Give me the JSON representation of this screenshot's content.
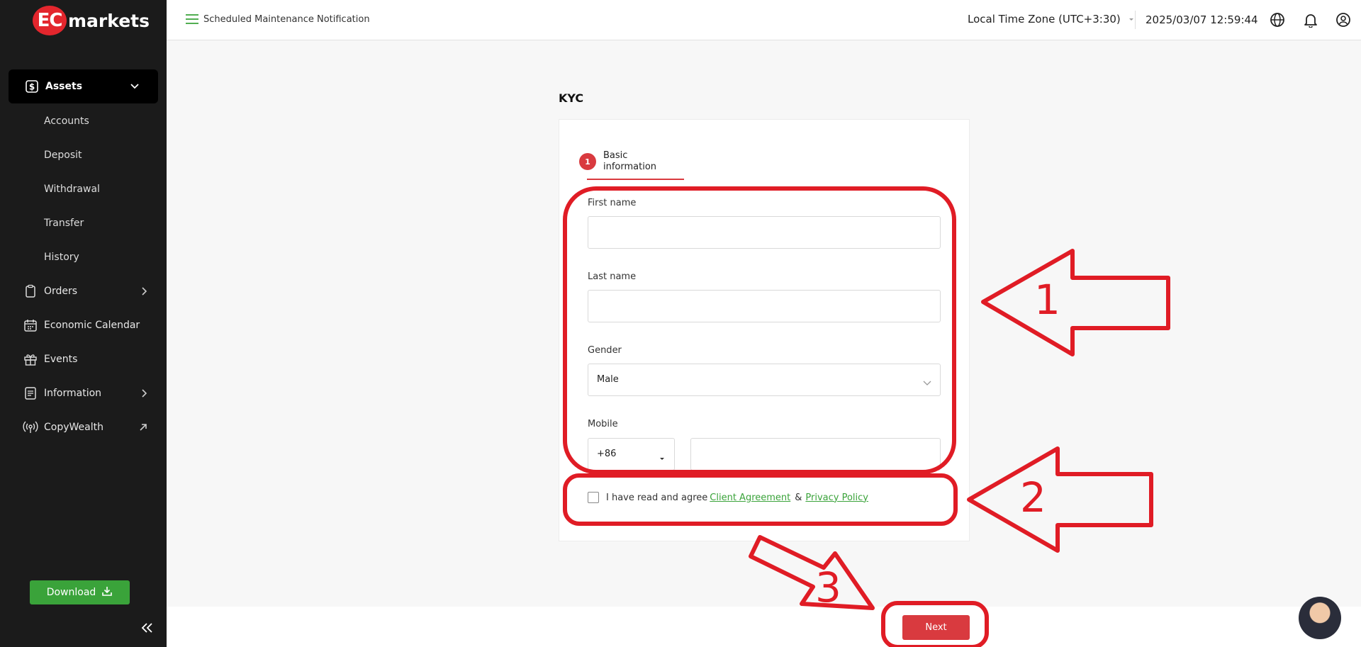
{
  "brand": {
    "logo_mark": "EC",
    "logo_text": "markets"
  },
  "sidebar": {
    "active": {
      "label": "Assets",
      "icon": "dollar-icon"
    },
    "sub_items": [
      "Accounts",
      "Deposit",
      "Withdrawal",
      "Transfer",
      "History"
    ],
    "items": [
      {
        "label": "Orders",
        "icon": "clipboard-icon",
        "arrow": "chevron-right"
      },
      {
        "label": "Economic Calendar",
        "icon": "calendar-icon"
      },
      {
        "label": "Events",
        "icon": "gift-icon"
      },
      {
        "label": "Information",
        "icon": "document-icon",
        "arrow": "chevron-right"
      },
      {
        "label": "CopyWealth",
        "icon": "broadcast-icon",
        "arrow": "external-arrow"
      }
    ],
    "download_label": "Download"
  },
  "header": {
    "notification": "Scheduled Maintenance Notification",
    "timezone": "Local Time Zone (UTC+3:30)",
    "datetime": "2025/03/07 12:59:44"
  },
  "kyc": {
    "title": "KYC",
    "step_number": "1",
    "step_label": "Basic information",
    "first_name_label": "First name",
    "first_name_value": "",
    "last_name_label": "Last name",
    "last_name_value": "",
    "gender_label": "Gender",
    "gender_value": "Male",
    "mobile_label": "Mobile",
    "country_code": "+86",
    "phone_value": "",
    "agree_text": "I have read and agree",
    "client_agreement": "Client Agreement",
    "amp": "&",
    "privacy_policy": "Privacy Policy",
    "next_label": "Next"
  },
  "annotations": {
    "one": "1",
    "two": "2",
    "three": "3"
  },
  "colors": {
    "accent_red": "#d93a3f",
    "green": "#3aa33a",
    "annotation_red": "#e01c25",
    "sidebar_bg": "#1b1b1b"
  }
}
